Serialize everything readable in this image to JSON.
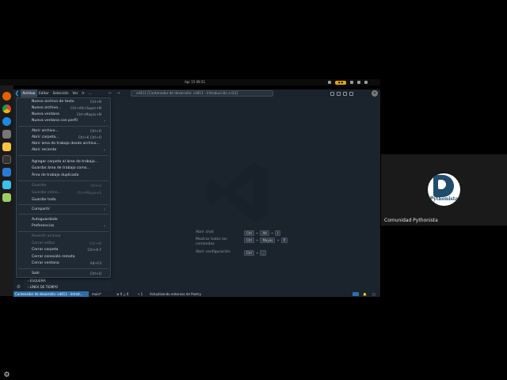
{
  "top_bar": {
    "clock": "Apr 15 09:51",
    "badge": "● ●"
  },
  "titlebar": {
    "menus": [
      "Archivo",
      "Editar",
      "Selección",
      "Ver",
      "Ir",
      "..."
    ],
    "nav_back": "←",
    "nav_forward": "→",
    "command_center": "cd411 [Contenedor de desarrollo: cd411 - Introducción a Git]"
  },
  "file_menu": {
    "items": [
      {
        "label": "Nuevo archivo de texto",
        "shortcut": "Ctrl+N"
      },
      {
        "label": "Nuevo archivo...",
        "shortcut": "Ctrl+Alt+Super+N"
      },
      {
        "label": "Nueva ventana",
        "shortcut": "Ctrl+Mayús+N"
      },
      {
        "label": "Nueva ventana con perfil",
        "shortcut": "",
        "submenu": true
      },
      {
        "label": "Abrir archivo...",
        "shortcut": "Ctrl+O"
      },
      {
        "label": "Abrir carpeta...",
        "shortcut": "Ctrl+K Ctrl+O"
      },
      {
        "label": "Abrir área de trabajo desde archivo...",
        "shortcut": ""
      },
      {
        "label": "Abrir reciente",
        "shortcut": "",
        "submenu": true
      },
      {
        "label": "Agregar carpeta al área de trabajo...",
        "shortcut": ""
      },
      {
        "label": "Guardar área de trabajo como...",
        "shortcut": ""
      },
      {
        "label": "Área de trabajo duplicada",
        "shortcut": ""
      },
      {
        "label": "Guardar",
        "shortcut": "Ctrl+S",
        "disabled": true
      },
      {
        "label": "Guardar como...",
        "shortcut": "Ctrl+Mayús+S",
        "disabled": true
      },
      {
        "label": "Guardar todo",
        "shortcut": ""
      },
      {
        "label": "Compartir",
        "shortcut": "",
        "submenu": true
      },
      {
        "label": "Autoguardado",
        "shortcut": ""
      },
      {
        "label": "Preferencias",
        "shortcut": "",
        "submenu": true
      },
      {
        "label": "Revertir archivo",
        "shortcut": "",
        "disabled": true
      },
      {
        "label": "Cerrar editor",
        "shortcut": "Ctrl+W",
        "disabled": true
      },
      {
        "label": "Cerrar carpeta",
        "shortcut": "Ctrl+K F"
      },
      {
        "label": "Cerrar conexión remota",
        "shortcut": ""
      },
      {
        "label": "Cerrar ventana",
        "shortcut": "Alt+F4"
      },
      {
        "label": "Salir",
        "shortcut": "Ctrl+Q"
      }
    ]
  },
  "sidebar": {
    "outline": "› ESQUEMA",
    "timeline": "› LÍNEA DE TIEMPO"
  },
  "editor_hints": [
    {
      "label": "Abrir chat",
      "keys": [
        "Ctrl",
        "Alt",
        "I"
      ]
    },
    {
      "label": "Mostrar todos los comandos",
      "keys": [
        "Ctrl",
        "Mayús",
        "P"
      ]
    },
    {
      "label": "Abrir configuración",
      "keys": [
        "Ctrl",
        ","
      ]
    }
  ],
  "statusbar": {
    "remote": "Contenedor de desarrollo: cd411 - Introd...",
    "branch": "main*",
    "problems": "⊗ 0 △ 0",
    "ports": "⑂ 1",
    "task": "Actualizando entornos de Poetry"
  },
  "community": {
    "name": "Comunidad Pythonista",
    "logo_text": "Pythonista"
  },
  "colors": {
    "accent": "#2b6fa8",
    "vscode_blue": "#3aa1e8",
    "badge": "#e5a50a"
  }
}
